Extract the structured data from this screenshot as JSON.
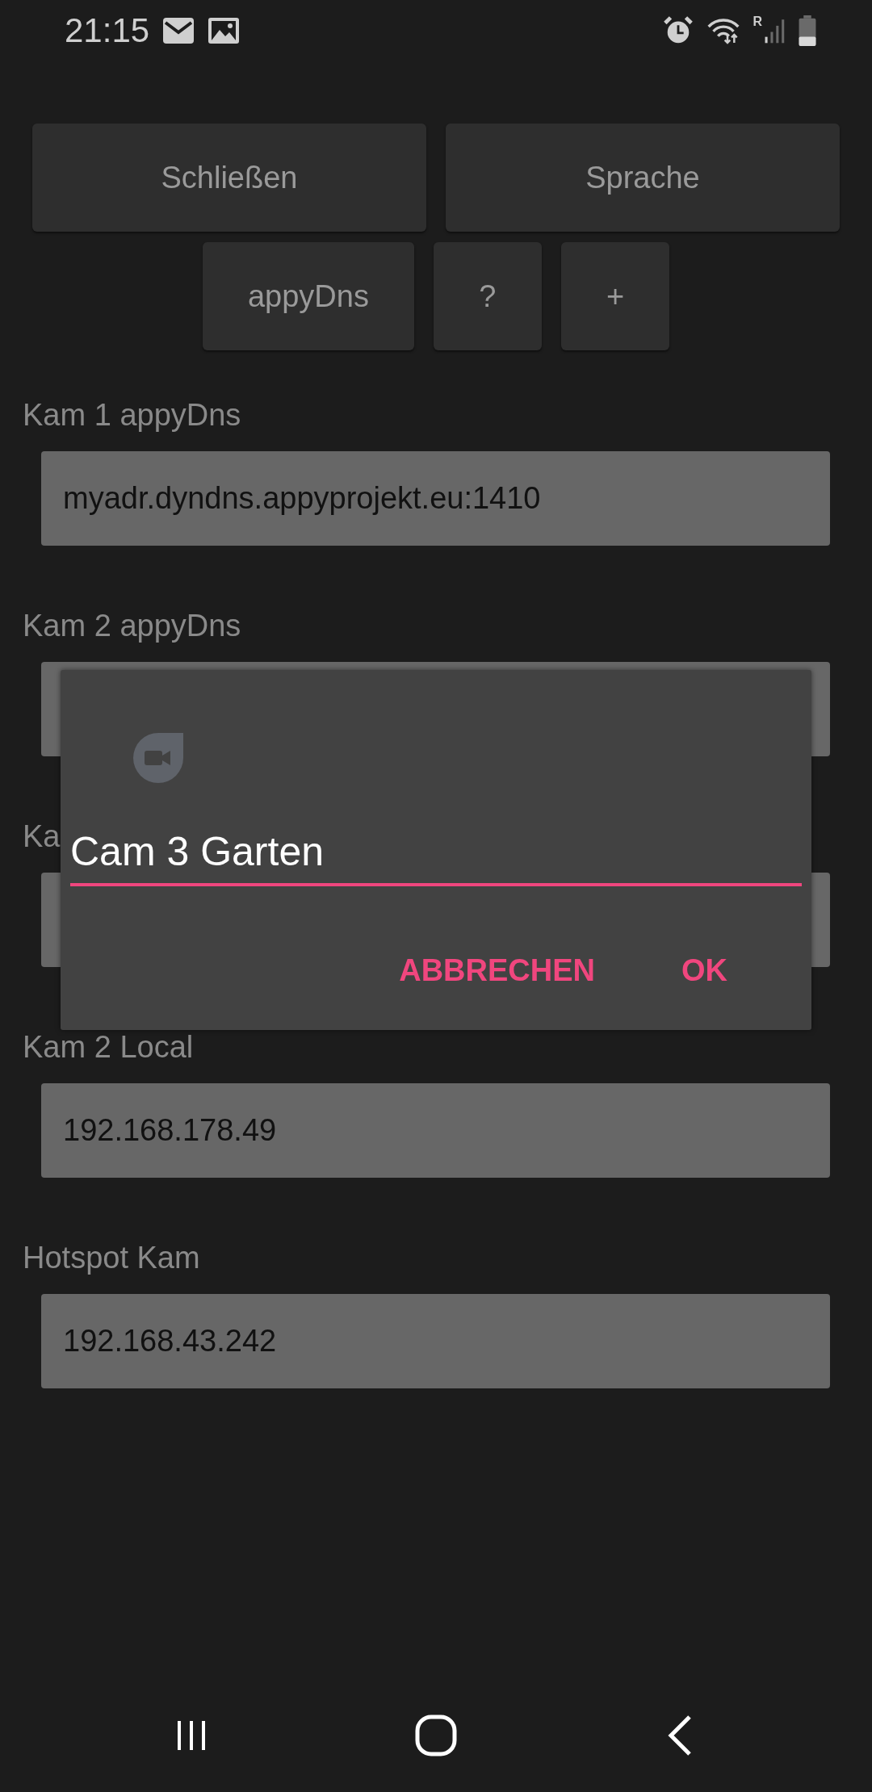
{
  "status_bar": {
    "time": "21:15",
    "roaming": "R"
  },
  "toolbar_rows": [
    {
      "buttons": [
        "Schließen",
        "Sprache"
      ],
      "kind": "wide"
    },
    {
      "buttons": [
        "appyDns",
        "?",
        "+"
      ],
      "kind": "compact"
    }
  ],
  "sections": [
    {
      "label": "Kam 1 appyDns",
      "value": "myadr.dyndns.appyprojekt.eu:1410"
    },
    {
      "label": "Kam 2 appyDns"
    },
    {
      "label": "Ka"
    },
    {
      "label": "Kam 2 Local",
      "value": "192.168.178.49"
    },
    {
      "label": "Hotspot Kam",
      "value": "192.168.43.242"
    }
  ],
  "dialog": {
    "value": "Cam 3 Garten",
    "buttons": [
      "ABBRECHEN",
      "OK"
    ]
  }
}
